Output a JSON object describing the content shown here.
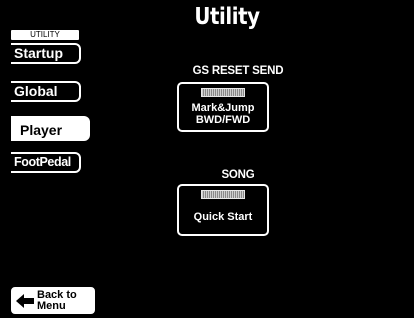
{
  "header": {
    "title": "Utility"
  },
  "sidebar": {
    "section_label": "UTILITY",
    "tabs": [
      {
        "label": "Startup",
        "selected": false
      },
      {
        "label": "Global",
        "selected": false
      },
      {
        "label": "Player",
        "selected": true
      },
      {
        "label": "FootPedal",
        "selected": false
      }
    ]
  },
  "main": {
    "gs_reset": {
      "title": "GS RESET SEND",
      "button_line1": "Mark&Jump",
      "button_line2": "BWD/FWD"
    },
    "song": {
      "title": "SONG",
      "button_label": "Quick Start"
    }
  },
  "footer": {
    "back_line1": "Back to",
    "back_line2": "Menu"
  },
  "colors": {
    "background": "#000000",
    "foreground": "#ffffff"
  }
}
